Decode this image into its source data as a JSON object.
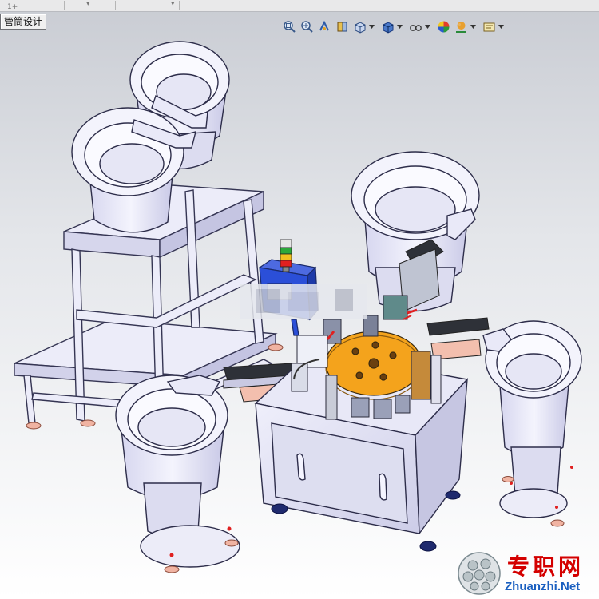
{
  "window": {
    "tab_fragment": "一1+",
    "tab_label": "管筒设计"
  },
  "toolbar": {
    "icons": [
      "zoom-to-fit-icon",
      "zoom-to-area-icon",
      "previous-view-icon",
      "section-view-icon",
      "view-orientation-icon",
      "display-style-icon",
      "hide-show-items-icon",
      "edit-appearance-icon",
      "apply-scene-icon",
      "view-settings-icon"
    ]
  },
  "watermark": {
    "cn_text": "专职网",
    "en_text": "Zhuanzhi.Net"
  },
  "colors": {
    "part_fill": "#eeeefa",
    "part_shade": "#c9c9e6",
    "part_edge": "#3a3a55",
    "turntable": "#f4a31c",
    "feeder_track": "#3a3d44",
    "pad": "#f2b6a6",
    "blue_box": "#2b4fd8",
    "red_accent": "#e02020",
    "foot_dark": "#1f2a6e"
  }
}
